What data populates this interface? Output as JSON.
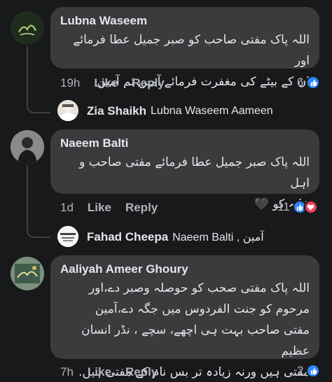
{
  "comments": [
    {
      "name": "Lubna Waseem",
      "text_line1": "اللہ پاک مفتی صاحب کو صبر جمیل عطا فرمائے اور",
      "text_line2": "ان کے بیٹے کی مغفرت فرمائے آمین ثم آمین",
      "time": "19h",
      "like": "Like",
      "reply": "Reply",
      "reaction_count": "6"
    },
    {
      "name": "Naeem Balti",
      "text_line1": "اللہ پاک صبر جمیل عطا فرمائے مفتی صاحب و اہل",
      "text_line2": "خانہ کو",
      "emoji": "🖤",
      "time": "1d",
      "like": "Like",
      "reply": "Reply",
      "reaction_count": "11"
    },
    {
      "name": "Aaliyah Ameer Ghoury",
      "text_line1": "اللہ پاک مفتی صحب کو حوصلہ وصبر دے،اور",
      "text_line2": "مرحوم کو جنت الفردوس میں جگہ دے،آمین",
      "text_line3": "مفتی صاحب بہت ہی اچھے، سچے ، نڈر انسان عظیم",
      "text_line4": "مفتی ہیں ورنہ زیادہ تر بس نام کے مفتی ہیں.",
      "time": "7h",
      "like": "Like",
      "reply": "Reply",
      "reaction_count": "2"
    }
  ],
  "replies": [
    {
      "name": "Zia Shaikh",
      "text": "Lubna Waseem Aameen"
    },
    {
      "name": "Fahad Cheepa",
      "text": "Naeem Balti , آمین"
    }
  ],
  "colors": {
    "background": "#18191a",
    "bubble": "#3a3b3c",
    "like_blue": "#2d88ff",
    "love_red": "#f33e58"
  }
}
